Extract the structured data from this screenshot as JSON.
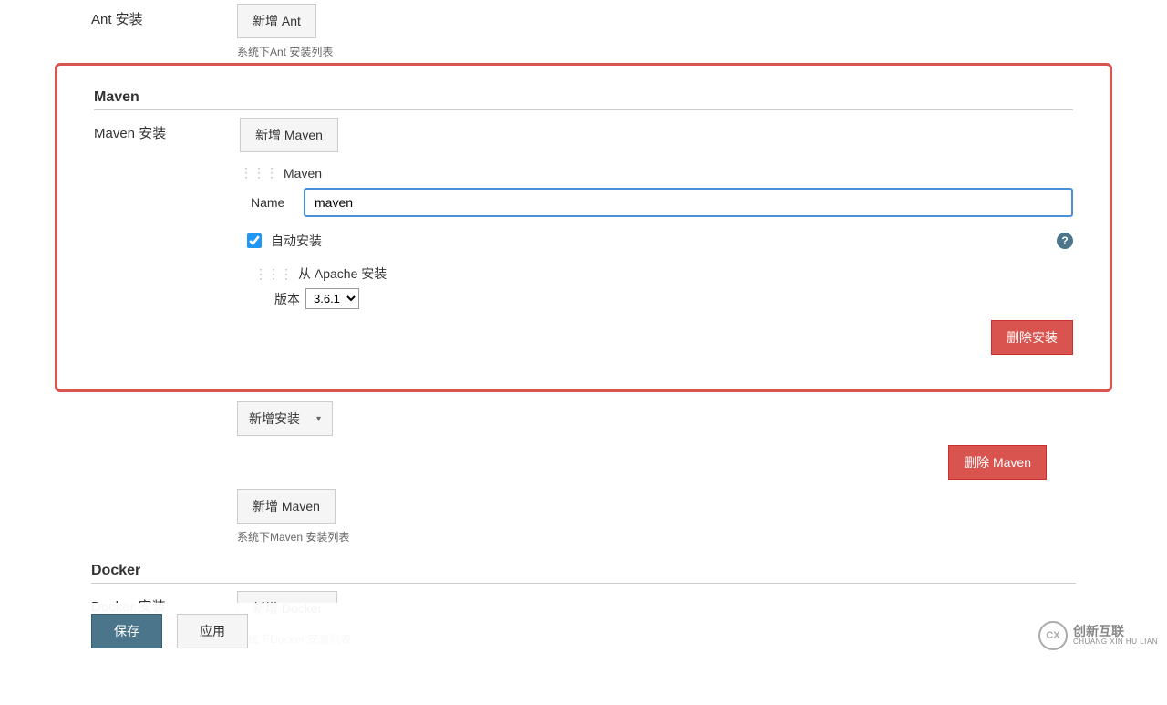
{
  "ant": {
    "label": "Ant 安装",
    "add_button": "新增 Ant",
    "desc": "系统下Ant 安装列表"
  },
  "maven": {
    "title": "Maven",
    "label": "Maven 安装",
    "add_button": "新增 Maven",
    "installer_title": "Maven",
    "name_label": "Name",
    "name_value": "maven",
    "auto_install_label": "自动安装",
    "auto_install_checked": true,
    "apache_title": "从 Apache 安装",
    "version_label": "版本",
    "version_value": "3.6.1",
    "delete_installer": "删除安装",
    "add_installer": "新增安装",
    "delete_maven": "删除 Maven",
    "add_button_2": "新增 Maven",
    "desc": "系统下Maven 安装列表"
  },
  "docker": {
    "title": "Docker",
    "label": "Docker 安装",
    "add_button": "新增 Docker",
    "desc": "系统下Docker 安装列表"
  },
  "footer": {
    "save": "保存",
    "apply": "应用"
  },
  "watermark": {
    "line1": "创新互联",
    "line2": "CHUANG XIN HU LIAN"
  }
}
